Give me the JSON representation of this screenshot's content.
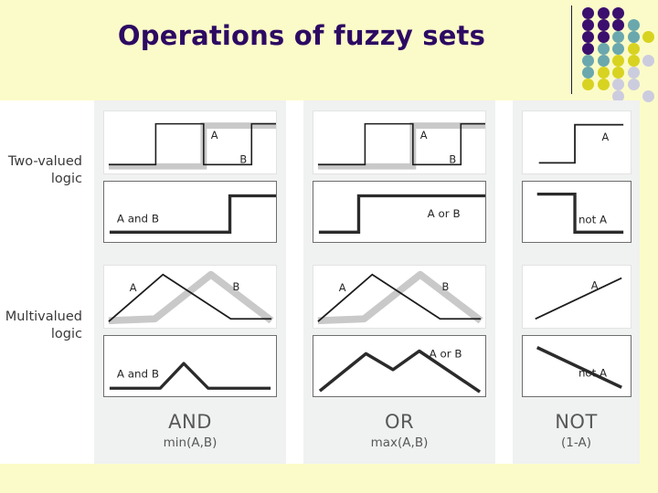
{
  "slide": {
    "title": "Operations of fuzzy sets",
    "background_color": "#fbfbc9",
    "title_color": "#2d0a63"
  },
  "decoration": {
    "name": "dot-grid",
    "colors": {
      "purple": "#3b0f6e",
      "teal": "#6aa8ae",
      "yellow": "#d8d320",
      "lavender": "#ccccdf"
    },
    "dots": [
      {
        "col": 0,
        "row": 0,
        "color": "#3b0f6e"
      },
      {
        "col": 1,
        "row": 0,
        "color": "#3b0f6e"
      },
      {
        "col": 2,
        "row": 0,
        "color": "#3b0f6e"
      },
      {
        "col": 0,
        "row": 1,
        "color": "#3b0f6e"
      },
      {
        "col": 1,
        "row": 1,
        "color": "#3b0f6e"
      },
      {
        "col": 2,
        "row": 1,
        "color": "#3b0f6e"
      },
      {
        "col": 3,
        "row": 1,
        "color": "#6aa8ae"
      },
      {
        "col": 0,
        "row": 2,
        "color": "#3b0f6e"
      },
      {
        "col": 1,
        "row": 2,
        "color": "#3b0f6e"
      },
      {
        "col": 2,
        "row": 2,
        "color": "#6aa8ae"
      },
      {
        "col": 3,
        "row": 2,
        "color": "#6aa8ae"
      },
      {
        "col": 4,
        "row": 2,
        "color": "#d8d320"
      },
      {
        "col": 0,
        "row": 3,
        "color": "#3b0f6e"
      },
      {
        "col": 1,
        "row": 3,
        "color": "#6aa8ae"
      },
      {
        "col": 2,
        "row": 3,
        "color": "#6aa8ae"
      },
      {
        "col": 3,
        "row": 3,
        "color": "#d8d320"
      },
      {
        "col": 0,
        "row": 4,
        "color": "#6aa8ae"
      },
      {
        "col": 1,
        "row": 4,
        "color": "#6aa8ae"
      },
      {
        "col": 2,
        "row": 4,
        "color": "#d8d320"
      },
      {
        "col": 3,
        "row": 4,
        "color": "#d8d320"
      },
      {
        "col": 4,
        "row": 4,
        "color": "#ccccdf"
      },
      {
        "col": 0,
        "row": 5,
        "color": "#6aa8ae"
      },
      {
        "col": 1,
        "row": 5,
        "color": "#d8d320"
      },
      {
        "col": 2,
        "row": 5,
        "color": "#d8d320"
      },
      {
        "col": 3,
        "row": 5,
        "color": "#ccccdf"
      },
      {
        "col": 0,
        "row": 6,
        "color": "#d8d320"
      },
      {
        "col": 1,
        "row": 6,
        "color": "#d8d320"
      },
      {
        "col": 2,
        "row": 6,
        "color": "#ccccdf"
      },
      {
        "col": 3,
        "row": 6,
        "color": "#ccccdf"
      },
      {
        "col": 2,
        "row": 7,
        "color": "#ccccdf"
      },
      {
        "col": 4,
        "row": 7,
        "color": "#ccccdf"
      }
    ]
  },
  "rows": {
    "two_valued": "Two-valued\nlogic",
    "two_valued_line1": "Two-valued",
    "two_valued_line2": "logic",
    "multivalued_line1": "Multivalued",
    "multivalued_line2": "logic"
  },
  "columns": [
    {
      "id": "and",
      "operation": "AND",
      "formula": "min(A,B)",
      "two_valued": {
        "input_labels": [
          "A",
          "B"
        ],
        "result_label": "A and B"
      },
      "multivalued": {
        "input_labels": [
          "A",
          "B"
        ],
        "result_label": "A and B"
      }
    },
    {
      "id": "or",
      "operation": "OR",
      "formula": "max(A,B)",
      "two_valued": {
        "input_labels": [
          "A",
          "B"
        ],
        "result_label": "A or B"
      },
      "multivalued": {
        "input_labels": [
          "A",
          "B"
        ],
        "result_label": "A or B"
      }
    },
    {
      "id": "not",
      "operation": "NOT",
      "formula": "(1-A)",
      "two_valued": {
        "input_labels": [
          "A"
        ],
        "result_label": "not A"
      },
      "multivalued": {
        "input_labels": [
          "A"
        ],
        "result_label": "not A"
      }
    }
  ],
  "chart_data": {
    "type": "line",
    "title": "Operations of fuzzy sets",
    "description": "Six pairs of membership-function plots comparing two-valued (crisp) logic with multivalued (fuzzy) logic for the AND, OR and NOT operations.",
    "grid": false,
    "legend": "inline",
    "xlim": [
      0,
      1
    ],
    "ylim": [
      0,
      1
    ],
    "panels": [
      {
        "panel": "two-valued-and-inputs",
        "series": [
          {
            "name": "A",
            "style": "thin-black",
            "x": [
              0.0,
              0.28,
              0.28,
              0.58,
              0.58,
              1.0
            ],
            "y": [
              0.1,
              0.1,
              0.9,
              0.9,
              0.1,
              0.1
            ]
          },
          {
            "name": "B",
            "style": "thick-grey",
            "x": [
              0.0,
              0.58,
              0.58,
              1.0
            ],
            "y": [
              0.1,
              0.1,
              0.9,
              0.9
            ]
          }
        ]
      },
      {
        "panel": "two-valued-and-result",
        "series": [
          {
            "name": "A and B",
            "style": "thick-black",
            "x": [
              0.0,
              0.78,
              0.78,
              1.0
            ],
            "y": [
              0.12,
              0.12,
              0.88,
              0.88
            ]
          }
        ]
      },
      {
        "panel": "two-valued-or-inputs",
        "series": [
          {
            "name": "A",
            "style": "thin-black",
            "x": [
              0.0,
              0.28,
              0.28,
              0.58,
              0.58,
              1.0
            ],
            "y": [
              0.1,
              0.1,
              0.9,
              0.9,
              0.1,
              0.1
            ]
          },
          {
            "name": "B",
            "style": "thick-grey",
            "x": [
              0.0,
              0.58,
              0.58,
              1.0
            ],
            "y": [
              0.1,
              0.1,
              0.9,
              0.9
            ]
          }
        ]
      },
      {
        "panel": "two-valued-or-result",
        "series": [
          {
            "name": "A or B",
            "style": "thick-black",
            "x": [
              0.0,
              0.26,
              0.26,
              1.0
            ],
            "y": [
              0.12,
              0.12,
              0.88,
              0.88
            ]
          }
        ]
      },
      {
        "panel": "two-valued-not-input",
        "series": [
          {
            "name": "A",
            "style": "thin-black",
            "x": [
              0.0,
              0.55,
              0.55,
              1.0
            ],
            "y": [
              0.12,
              0.12,
              0.88,
              0.88
            ]
          }
        ]
      },
      {
        "panel": "two-valued-not-result",
        "series": [
          {
            "name": "not A",
            "style": "thick-black",
            "x": [
              0.0,
              0.55,
              0.55,
              1.0
            ],
            "y": [
              0.88,
              0.88,
              0.12,
              0.12
            ]
          }
        ]
      },
      {
        "panel": "multivalued-and-inputs",
        "series": [
          {
            "name": "A",
            "style": "thin-black",
            "x": [
              0.0,
              0.34,
              0.74,
              1.0
            ],
            "y": [
              0.05,
              0.95,
              0.08,
              0.08
            ]
          },
          {
            "name": "B",
            "style": "thick-grey",
            "x": [
              0.0,
              0.3,
              0.62,
              1.0
            ],
            "y": [
              0.05,
              0.08,
              0.95,
              0.05
            ]
          }
        ]
      },
      {
        "panel": "multivalued-and-result",
        "series": [
          {
            "name": "A and B",
            "style": "thick-black",
            "x": [
              0.0,
              0.34,
              0.5,
              0.68,
              1.0
            ],
            "y": [
              0.1,
              0.1,
              0.7,
              0.1,
              0.1
            ]
          }
        ]
      },
      {
        "panel": "multivalued-or-inputs",
        "series": [
          {
            "name": "A",
            "style": "thin-black",
            "x": [
              0.0,
              0.34,
              0.74,
              1.0
            ],
            "y": [
              0.05,
              0.95,
              0.08,
              0.08
            ]
          },
          {
            "name": "B",
            "style": "thick-grey",
            "x": [
              0.0,
              0.3,
              0.62,
              1.0
            ],
            "y": [
              0.05,
              0.08,
              0.95,
              0.05
            ]
          }
        ]
      },
      {
        "panel": "multivalued-or-result",
        "series": [
          {
            "name": "A or B",
            "style": "thick-black",
            "x": [
              0.0,
              0.3,
              0.46,
              0.62,
              1.0
            ],
            "y": [
              0.07,
              0.9,
              0.52,
              0.92,
              0.05
            ]
          }
        ]
      },
      {
        "panel": "multivalued-not-input",
        "series": [
          {
            "name": "A",
            "style": "thin-black",
            "x": [
              0.0,
              1.0
            ],
            "y": [
              0.08,
              0.92
            ]
          }
        ]
      },
      {
        "panel": "multivalued-not-result",
        "series": [
          {
            "name": "not A",
            "style": "thick-black",
            "x": [
              0.0,
              1.0
            ],
            "y": [
              0.92,
              0.08
            ]
          }
        ]
      }
    ]
  }
}
